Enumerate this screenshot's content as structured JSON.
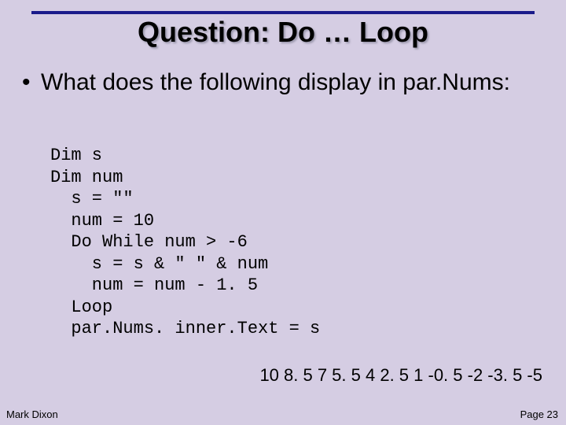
{
  "slide": {
    "title": "Question: Do … Loop",
    "bullet": "What does the following display in par.Nums:",
    "code": "Dim s\nDim num\n  s = \"\"\n  num = 10\n  Do While num > -6\n    s = s & \" \" & num\n    num = num - 1. 5\n  Loop\n  par.Nums. inner.Text = s",
    "answer": "10 8. 5 7 5. 5 4 2. 5 1 -0. 5 -2 -3. 5 -5"
  },
  "footer": {
    "author": "Mark Dixon",
    "page": "Page 23"
  }
}
